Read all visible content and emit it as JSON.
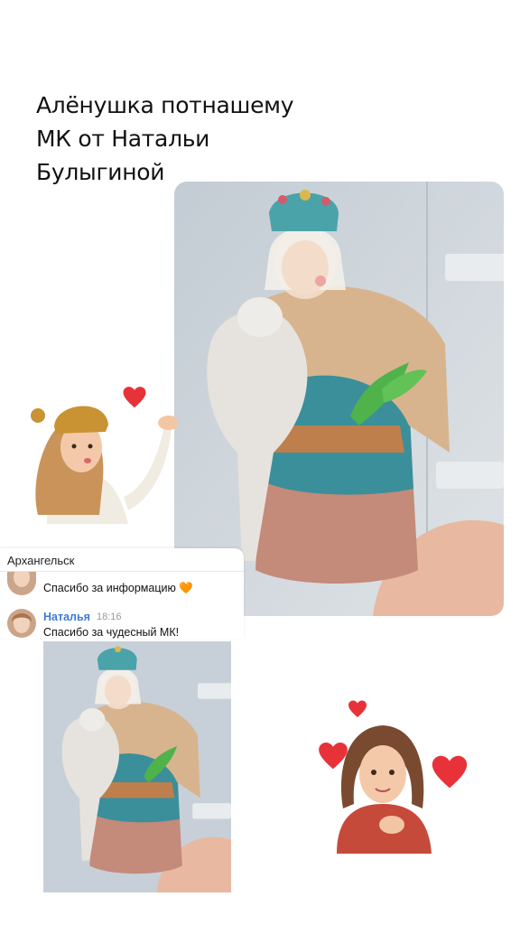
{
  "title": {
    "line1": "Алёнушка потнашему",
    "line2": "МК от Натальи",
    "line3": "Булыгиной"
  },
  "chat": {
    "location": "Архангельск",
    "messages": [
      {
        "text": "Спасибо за информацию 🧡"
      },
      {
        "author": "Наталья",
        "time": "18:16",
        "text": "Спасибо за чудесный МК!"
      }
    ]
  },
  "colors": {
    "heart": "#e8323a",
    "author": "#3b7bd6",
    "photo_bg": "#c9d3dc"
  },
  "icons": {
    "heart": "heart-icon"
  }
}
